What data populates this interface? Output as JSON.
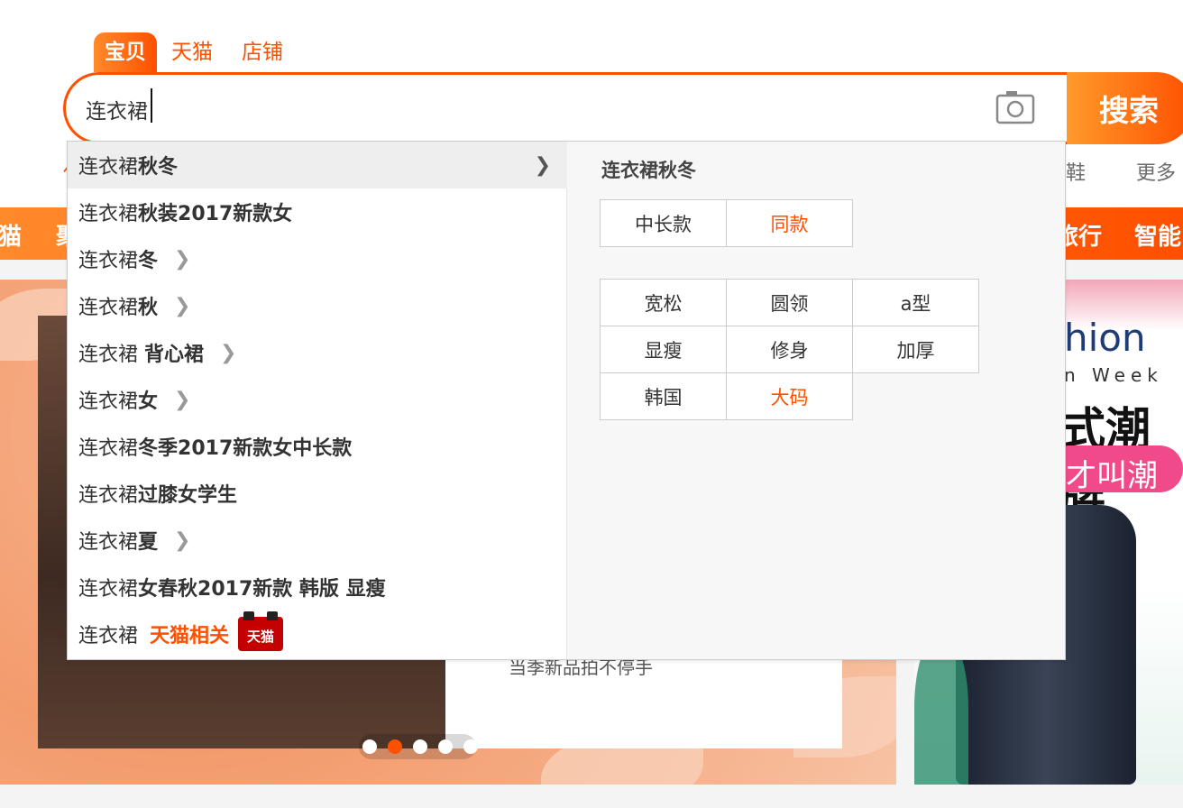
{
  "search": {
    "tabs": [
      "宝贝",
      "天猫",
      "店铺"
    ],
    "active_tab": "宝贝",
    "query": "连衣裙",
    "button_label": "搜索"
  },
  "background": {
    "hot_words_left": "休",
    "hot_words_right": [
      "鞋",
      "更多"
    ],
    "nav_items": [
      "猫",
      "聚",
      "旅行",
      "智能"
    ],
    "banner_card_text": "当季新品拍不停手",
    "side_banner": {
      "fashion": "hion",
      "week": "n Week",
      "title": "式潮牌",
      "pill": "才叫潮"
    },
    "carousel": {
      "count": 5,
      "active_index": 1
    }
  },
  "suggestions": [
    {
      "prefix": "连衣裙",
      "suffix": "秋冬",
      "has_more": true,
      "hover": true
    },
    {
      "prefix": "连衣裙",
      "suffix": "秋装2017新款女",
      "has_more": false
    },
    {
      "prefix": "连衣裙",
      "suffix": "冬",
      "has_more": true
    },
    {
      "prefix": "连衣裙",
      "suffix": "秋",
      "has_more": true
    },
    {
      "prefix": "连衣裙 ",
      "suffix": "背心裙",
      "has_more": true
    },
    {
      "prefix": "连衣裙",
      "suffix": "女",
      "has_more": true
    },
    {
      "prefix": "连衣裙",
      "suffix": "冬季2017新款女中长款",
      "has_more": false
    },
    {
      "prefix": "连衣裙",
      "suffix": "过膝女学生",
      "has_more": false
    },
    {
      "prefix": "连衣裙",
      "suffix": "夏",
      "has_more": true
    },
    {
      "prefix": "连衣裙",
      "suffix": "女春秋2017新款 韩版 显瘦",
      "has_more": false
    }
  ],
  "tmall_suggestion": {
    "prefix": "连衣裙 ",
    "label": "天猫相关",
    "badge": "天猫"
  },
  "detail": {
    "title": "连衣裙秋冬",
    "group1": [
      {
        "label": "中长款",
        "hot": false
      },
      {
        "label": "同款",
        "hot": true
      }
    ],
    "group2": [
      {
        "label": "宽松",
        "hot": false
      },
      {
        "label": "圆领",
        "hot": false
      },
      {
        "label": "a型",
        "hot": false
      },
      {
        "label": "显瘦",
        "hot": false
      },
      {
        "label": "修身",
        "hot": false
      },
      {
        "label": "加厚",
        "hot": false
      },
      {
        "label": "韩国",
        "hot": false
      },
      {
        "label": "大码",
        "hot": true
      }
    ]
  },
  "colors": {
    "accent": "#ff5000",
    "tmall_red": "#c40000"
  }
}
